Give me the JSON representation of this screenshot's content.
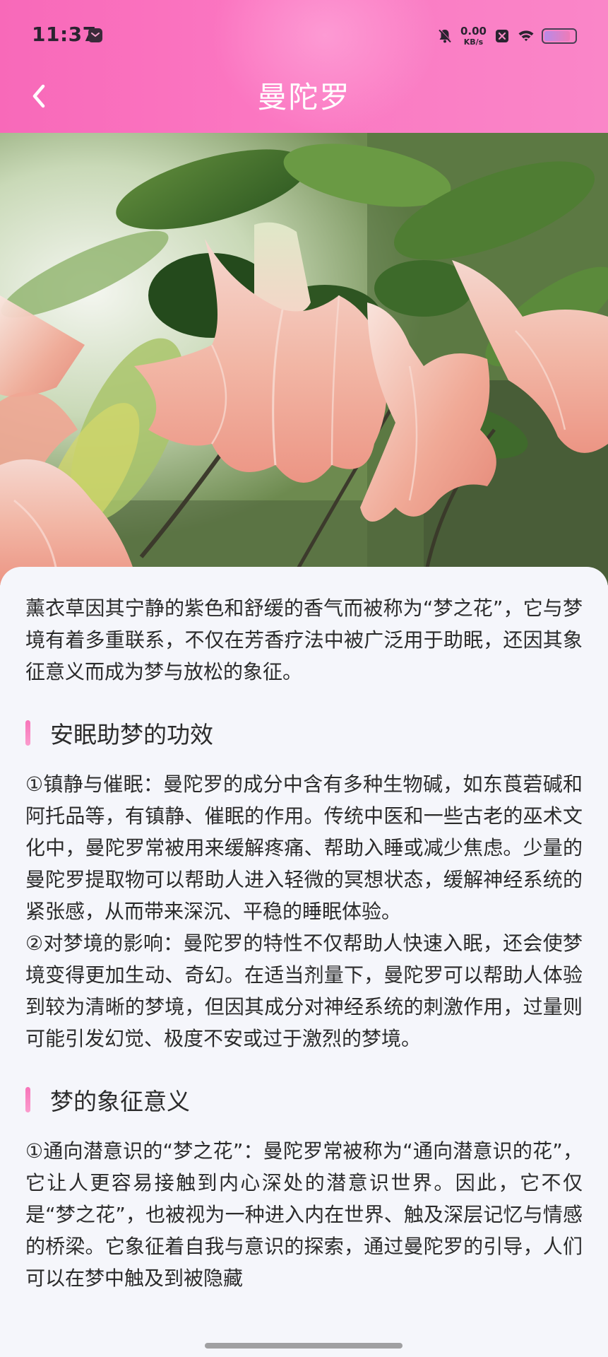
{
  "status_bar": {
    "time": "11:37",
    "net_speed_value": "0.00",
    "net_speed_unit": "KB/s",
    "battery_level": 0.85
  },
  "header": {
    "back_icon": "chevron-left-icon",
    "title": "曼陀罗"
  },
  "hero_image": {
    "subject": "pink trumpet flowers with green leaves"
  },
  "content": {
    "intro": "薰衣草因其宁静的紫色和舒缓的香气而被称为“梦之花”，它与梦境有着多重联系，不仅在芳香疗法中被广泛用于助眠，还因其象征意义而成为梦与放松的象征。",
    "sections": [
      {
        "title": "安眠助梦的功效",
        "paragraphs": [
          "①镇静与催眠：曼陀罗的成分中含有多种生物碱，如东莨菪碱和阿托品等，有镇静、催眠的作用。传统中医和一些古老的巫术文化中，曼陀罗常被用来缓解疼痛、帮助入睡或减少焦虑。少量的曼陀罗提取物可以帮助人进入轻微的冥想状态，缓解神经系统的紧张感，从而带来深沉、平稳的睡眠体验。",
          "②对梦境的影响：曼陀罗的特性不仅帮助人快速入眠，还会使梦境变得更加生动、奇幻。在适当剂量下，曼陀罗可以帮助人体验到较为清晰的梦境，但因其成分对神经系统的刺激作用，过量则可能引发幻觉、极度不安或过于激烈的梦境。"
        ]
      },
      {
        "title": "梦的象征意义",
        "paragraphs": [
          "①通向潜意识的“梦之花”：曼陀罗常被称为“通向潜意识的花”，它让人更容易接触到内心深处的潜意识世界。因此，它不仅是“梦之花”，也被视为一种进入内在世界、触及深层记忆与情感的桥梁。它象征着自我与意识的探索，通过曼陀罗的引导，人们可以在梦中触及到被隐藏"
        ]
      }
    ]
  },
  "colors": {
    "header_gradient_start": "#f869b9",
    "header_gradient_end": "#fa86c8",
    "section_bar": "#f774b9",
    "page_background": "#f5f6fb"
  }
}
